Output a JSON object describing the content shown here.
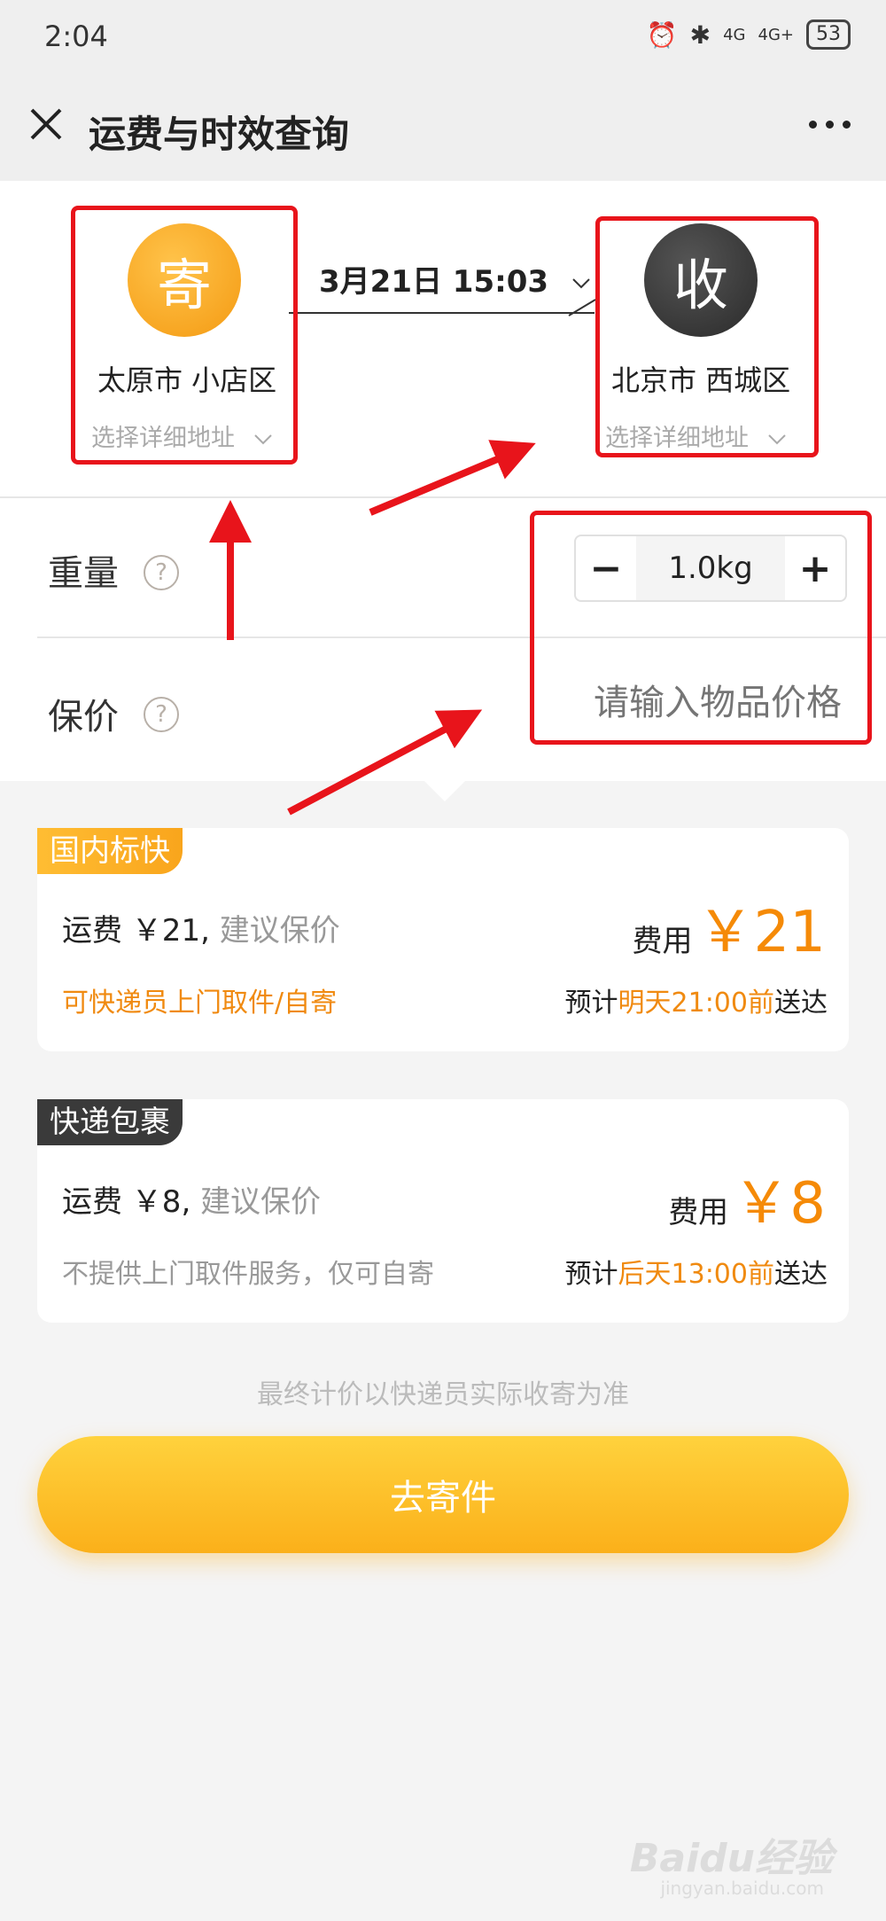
{
  "status": {
    "time": "2:04",
    "battery": "53",
    "signal1": "4G",
    "signal2": "4G+"
  },
  "nav": {
    "title": "运费与时效查询"
  },
  "route": {
    "sender": {
      "avatar": "寄",
      "city": "太原市 小店区",
      "detail": "选择详细地址"
    },
    "receiver": {
      "avatar": "收",
      "city": "北京市 西城区",
      "detail": "选择详细地址"
    },
    "datetime": "3月21日 15:03"
  },
  "weight": {
    "label": "重量",
    "value": "1.0kg",
    "minus": "−",
    "plus": "+"
  },
  "insurance": {
    "label": "保价",
    "placeholder": "请输入物品价格"
  },
  "options": [
    {
      "tag": "国内标快",
      "fee_label": "运费 ￥21,",
      "fee_hint": "建议保价",
      "cost_label": "费用",
      "cost": "￥21",
      "pickup": "可快递员上门取件/自寄",
      "eta_prefix": "预计",
      "eta_time": "明天21:00前",
      "eta_suffix": "送达"
    },
    {
      "tag": "快递包裹",
      "fee_label": "运费 ￥8,",
      "fee_hint": "建议保价",
      "cost_label": "费用",
      "cost": "￥8",
      "pickup": "不提供上门取件服务，仅可自寄",
      "eta_prefix": "预计",
      "eta_time": "后天13:00前",
      "eta_suffix": "送达"
    }
  ],
  "footnote": "最终计价以快递员实际收寄为准",
  "submit_label": "去寄件",
  "watermark": {
    "brand": "Baidu经验",
    "sub": "jingyan.baidu.com"
  },
  "colors": {
    "accent": "#f58a07",
    "button": "#fbb01a",
    "annotation": "#e8141b"
  }
}
